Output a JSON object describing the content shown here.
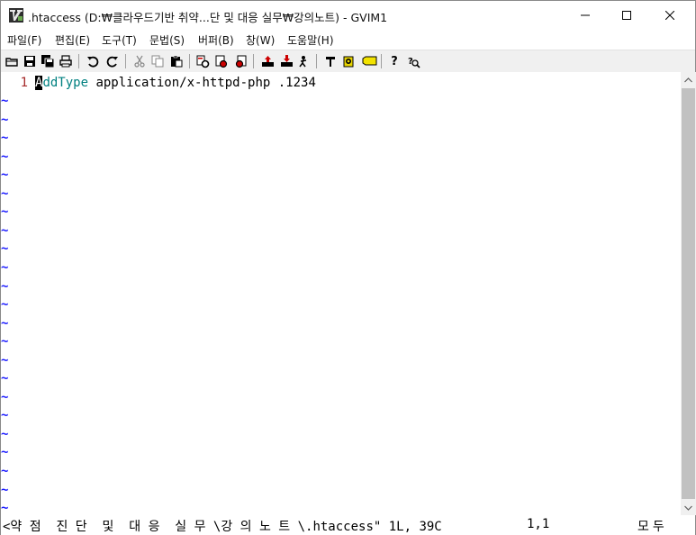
{
  "window": {
    "title": ".htaccess (D:₩클라우드기반 취약...단 및 대응 실무₩강의노트) - GVIM1"
  },
  "menu": {
    "items": [
      {
        "label": "파일(F)"
      },
      {
        "label": "편집(E)"
      },
      {
        "label": "도구(T)"
      },
      {
        "label": "문법(S)"
      },
      {
        "label": "버퍼(B)"
      },
      {
        "label": "창(W)"
      },
      {
        "label": "도움말(H)"
      }
    ]
  },
  "toolbar": {
    "icons": [
      "open-icon",
      "save-icon",
      "save-all-icon",
      "print-icon",
      "undo-icon",
      "redo-icon",
      "cut-icon",
      "copy-icon",
      "paste-icon",
      "replace-icon",
      "find-next-icon",
      "find-prev-icon",
      "load-session-icon",
      "save-session-icon",
      "run-script-icon",
      "make-icon",
      "shell-icon",
      "tags-icon",
      "help-icon",
      "find-help-icon"
    ]
  },
  "editor": {
    "line_number": "1",
    "cursor_char": "A",
    "keyword_rest": "ddType",
    "text_rest": " application/x-httpd-php .1234",
    "empty_marker": "~"
  },
  "status": {
    "message": "<약 점  진 단  및  대 응  실 무 \\강 의 노 트 \\.htaccess\" 1L, 39C",
    "position": "1,1",
    "percent": "모두"
  },
  "colors": {
    "line_number": "#a52a2a",
    "keyword": "#008080",
    "tilde": "#1a1aff",
    "cursor_bg": "#000000"
  }
}
